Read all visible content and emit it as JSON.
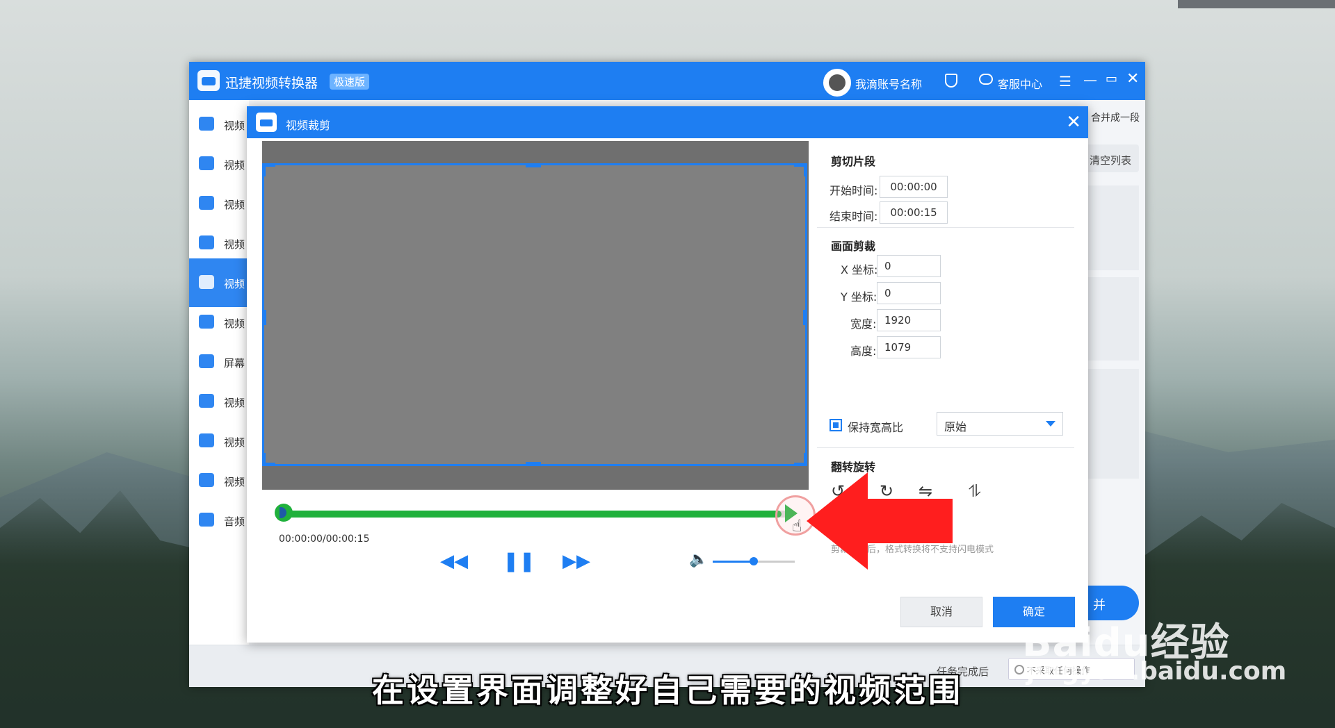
{
  "app": {
    "title": "迅捷视频转换器",
    "badge": "极速版",
    "account_name": "我滴账号名称",
    "service_label": "客服中心",
    "menu_glyph": "☰",
    "min_glyph": "—",
    "max_glyph": "▭",
    "close_glyph": "✕"
  },
  "sidebar": {
    "items": [
      {
        "label": "视频"
      },
      {
        "label": "视频"
      },
      {
        "label": "视频"
      },
      {
        "label": "视频"
      },
      {
        "label": "视频"
      },
      {
        "label": "视频"
      },
      {
        "label": "屏幕"
      },
      {
        "label": "视频"
      },
      {
        "label": "视频"
      },
      {
        "label": "视频"
      },
      {
        "label": "音频"
      }
    ],
    "active_index": 4
  },
  "background_panel": {
    "merge_label": "合并成一段",
    "clear_list": "清空列表",
    "merge_button": "并",
    "after_done_label": "任务完成后",
    "after_done_value": "不采取任何操作"
  },
  "dialog": {
    "title": "视频裁剪",
    "close_glyph": "✕",
    "player": {
      "time_readout": "00:00:00/00:00:15",
      "timeline_progress": 0.98,
      "volume_level": 0.5,
      "rewind_glyph": "◀◀",
      "pause_glyph": "❚❚",
      "forward_glyph": "▶▶",
      "volume_glyph": "🔈",
      "cursor_glyph": "☝"
    },
    "cut_segment": {
      "title": "剪切片段",
      "start_label": "开始时间:",
      "start_value": "00:00:00",
      "end_label": "结束时间:",
      "end_value": "00:00:15"
    },
    "crop": {
      "title": "画面剪裁",
      "x_label": "X 坐标:",
      "x_value": "0",
      "y_label": "Y 坐标:",
      "y_value": "0",
      "width_label": "宽度:",
      "width_value": "1920",
      "height_label": "高度:",
      "height_value": "1079",
      "keep_ratio_label": "保持宽高比",
      "keep_ratio_checked": true,
      "ratio_value": "原始"
    },
    "flip_rotate": {
      "title": "翻转旋转",
      "icons": [
        "rotate-left-icon",
        "rotate-right-icon",
        "flip-horizontal-icon",
        "flip-vertical-icon"
      ]
    },
    "note": "剪裁操作后，格式转换将不支持闪电模式",
    "cancel_label": "取消",
    "ok_label": "确定"
  },
  "overlay": {
    "subtitle": "在设置界面调整好自己需要的视频范围",
    "watermark_brand": "Baidu经验",
    "watermark_url": "jingyan.baidu.com",
    "arrow_color": "#ff1e1e"
  },
  "colors": {
    "accent": "#1e7ef2",
    "timeline": "#20b13c"
  }
}
